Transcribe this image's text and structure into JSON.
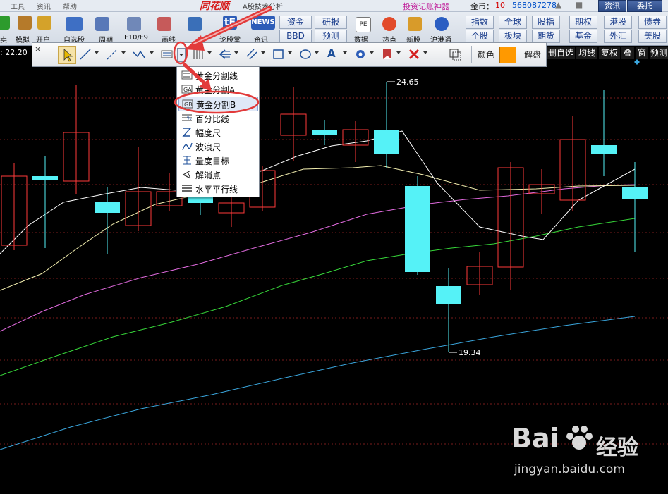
{
  "menubar": {
    "items": [
      "工具",
      "资讯",
      "帮助"
    ],
    "brand": "同花顺",
    "subtitle": "A股技术分析",
    "promo": "投资记账神器",
    "coins_label": "金币：",
    "coins_value": "10",
    "account": "568087278",
    "buttons": [
      "资讯",
      "委托"
    ]
  },
  "toolbar": {
    "icons": [
      {
        "label": "卖",
        "icon": "sell-icon"
      },
      {
        "label": "模拟",
        "icon": "hammer-icon"
      },
      {
        "label": "开户",
        "icon": "lock-icon"
      },
      {
        "label": "自选股",
        "icon": "star-icon"
      },
      {
        "label": "周期",
        "icon": "clock-icon"
      },
      {
        "label": "F10/F9",
        "icon": "f10-icon"
      },
      {
        "label": "画线",
        "icon": "pen-icon"
      },
      {
        "label": "",
        "icon": "monitor-icon"
      },
      {
        "label": "论股堂",
        "icon": "forum-icon"
      },
      {
        "label": "资讯",
        "icon": "news-icon"
      },
      {
        "label": "数据",
        "icon": "pe-icon"
      },
      {
        "label": "热点",
        "icon": "hot-icon"
      },
      {
        "label": "新股",
        "icon": "new-stock-icon"
      },
      {
        "label": "沪港通",
        "icon": "hk-connect-icon"
      }
    ],
    "news_text": "NEWS",
    "pe_text": "PE",
    "quick_buttons_row1": [
      "资金",
      "研报"
    ],
    "quick_buttons_row2": [
      "BBD",
      "预测"
    ],
    "group_buttons_row1": [
      "指数",
      "全球",
      "股指",
      "期权",
      "港股",
      "债券"
    ],
    "group_buttons_row2": [
      "个股",
      "板块",
      "期货",
      "基金",
      "外汇",
      "美股"
    ]
  },
  "price_readout": ": 22.20",
  "chart_right_buttons": [
    "删自选",
    "均线",
    "复权",
    "叠",
    "窗",
    "预测"
  ],
  "draw_toolbar": {
    "close": "×",
    "tools": [
      "select-arrow-icon",
      "line-icon",
      "ray-icon",
      "zigzag-icon",
      "golden-split-icon",
      "vertical-lines-icon",
      "arrow-left-icon",
      "parallel-channel-icon",
      "rectangle-icon",
      "ellipse-icon",
      "text-A-icon",
      "gear-icon",
      "bookmark-icon",
      "delete-x-icon",
      "copy-icon"
    ],
    "color_label": "颜色",
    "color_value": "#ff9900",
    "unlock_label": "解盘"
  },
  "dropdown": {
    "items": [
      {
        "label": "黄金分割线",
        "icon": "golden-line-icon"
      },
      {
        "label": "黄金分割A",
        "icon": "golden-a-icon"
      },
      {
        "label": "黄金分割B",
        "icon": "golden-b-icon",
        "selected": true
      },
      {
        "label": "百分比线",
        "icon": "percent-line-icon"
      },
      {
        "label": "幅度尺",
        "icon": "range-ruler-icon"
      },
      {
        "label": "波浪尺",
        "icon": "wave-ruler-icon"
      },
      {
        "label": "量度目标",
        "icon": "measure-target-icon"
      },
      {
        "label": "解消点",
        "icon": "resolve-point-icon"
      },
      {
        "label": "水平平行线",
        "icon": "horizontal-lines-icon"
      }
    ]
  },
  "chart": {
    "high_label": "24.65",
    "low_label": "19.34",
    "colors": {
      "up": "#ff3a3a",
      "down": "#55f2f7",
      "ma_white": "#ffffff",
      "ma_yellow": "#f4f0b0",
      "ma_magenta": "#e36be0",
      "ma_green": "#37d83a",
      "ma_blue": "#3aa6dd"
    }
  },
  "watermark": {
    "brand": "Bai",
    "brand_tail": "经验",
    "url": "jingyan.baidu.com"
  }
}
